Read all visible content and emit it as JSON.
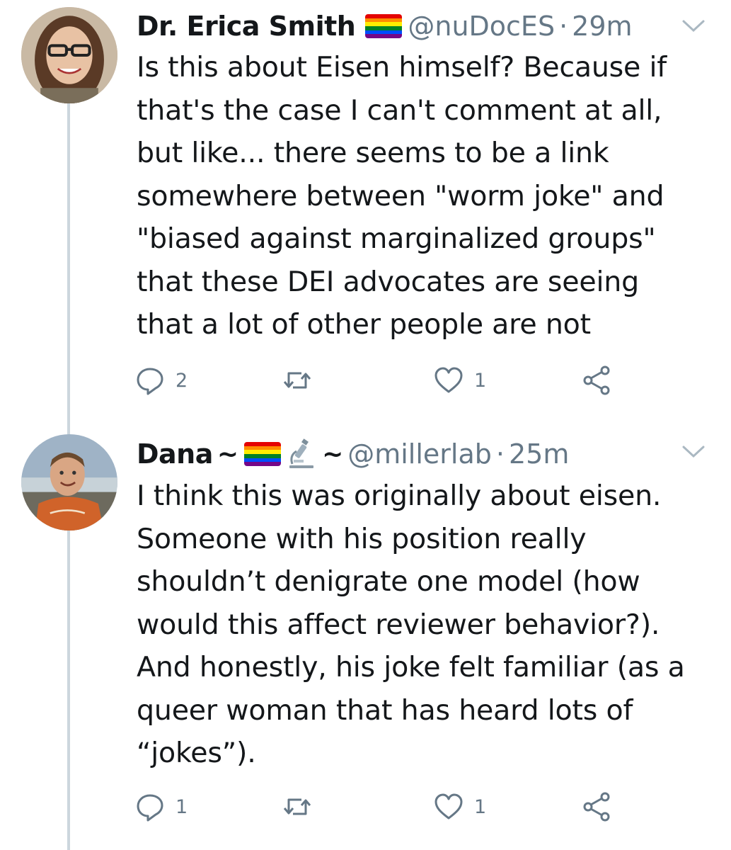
{
  "tweets": [
    {
      "name": "Dr. Erica Smith",
      "handle": "@nuDocES",
      "separator": "·",
      "time": "29m",
      "text": "Is this about Eisen himself? Because if\nthat's the case I can't comment at all,\nbut like... there seems to be a link\nsomewhere between \"worm joke\" and\n\"biased against marginalized groups\"\nthat these DEI advocates are seeing\nthat a lot of other people are not",
      "reply_count": "2",
      "retweet_count": "",
      "like_count": "1",
      "icons": [
        "rainbow-flag-icon",
        "reply-icon",
        "retweet-icon",
        "like-icon",
        "share-icon",
        "chevron-down-icon"
      ]
    },
    {
      "name_prefix": "Dana",
      "tilde_1": "~",
      "tilde_2": "~",
      "handle": "@millerlab",
      "separator": "·",
      "time": "25m",
      "text": "I think this was originally about eisen.\nSomeone with his position really\nshouldn’t denigrate one model (how\nwould this affect reviewer behavior?).\nAnd honestly, his joke felt familiar (as a\nqueer woman that has heard lots of\n“jokes”).",
      "reply_count": "1",
      "retweet_count": "",
      "like_count": "1",
      "icons": [
        "rainbow-flag-icon",
        "microscope-icon",
        "reply-icon",
        "retweet-icon",
        "like-icon",
        "share-icon",
        "chevron-down-icon"
      ]
    }
  ],
  "colors": {
    "text": "#14171a",
    "secondary": "#657786",
    "thread_line": "#ccd6dd",
    "flag": [
      "#e40303",
      "#ff8c00",
      "#ffed00",
      "#008026",
      "#004dff",
      "#750787"
    ]
  }
}
